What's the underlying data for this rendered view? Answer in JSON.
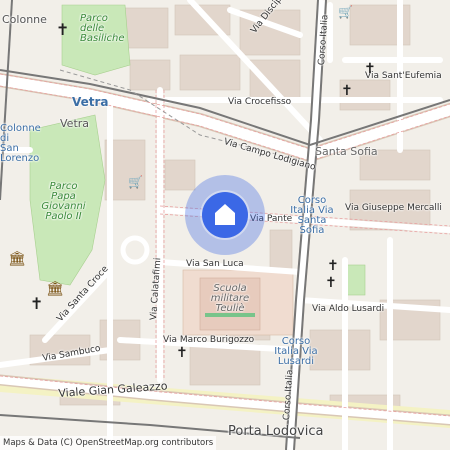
{
  "map": {
    "attribution": "Maps & Data (C) OpenStreetMap.org contributors",
    "colors": {
      "background": "#f2efe9",
      "road": "#ffffff",
      "casing": "#d9c7b5",
      "park": "#c9e8b8",
      "building": "#e2d6cc",
      "accent": "#3b68e6",
      "rail": "#777777"
    },
    "streets": [
      "Vetra",
      "Via Crocefisso",
      "Via Campo Lodigiano",
      "Via Disciplini",
      "Via Sant'Eufemia",
      "Corso Italia",
      "Via Giuseppe Mercalli",
      "Via Calatafimi",
      "Via San Luca",
      "Via Santa Croce",
      "Via Sambuco",
      "Via Marco Burigozzo",
      "Via Aldo Lusardi",
      "Viale Gian Galeazzo",
      "Via Pante",
      "Corso Italia"
    ],
    "places": [
      "Colonne",
      "Parco delle Basiliche",
      "Vetra",
      "Colonne di San Lorenzo",
      "Parco Papa Giovanni Paolo II",
      "Scuola militare Teuliè",
      "Santa Sofia",
      "Porta Lodovica"
    ],
    "stops": [
      "Corso Italia Via Santa Sofia",
      "Corso Italia Via Lusardi"
    ],
    "marker_icon": "home-icon"
  }
}
